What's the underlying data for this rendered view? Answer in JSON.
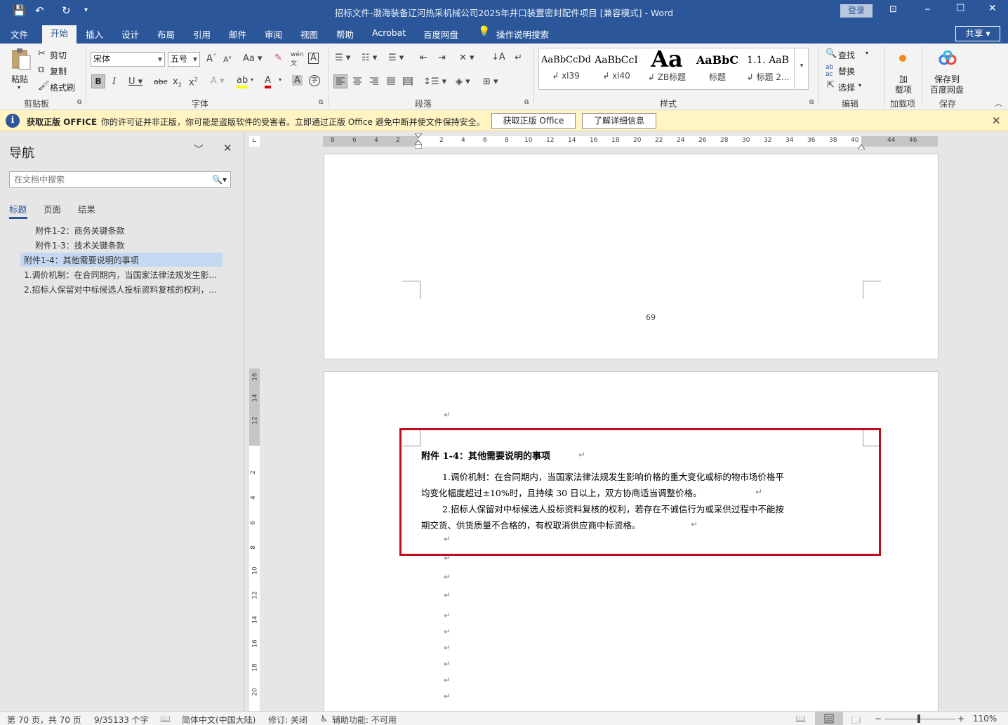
{
  "window": {
    "title": "招标文件-渤海装备辽河热采机械公司2025年井口装置密封配件项目 [兼容模式]  -  Word",
    "login": "登录",
    "controls": {
      "ribbon_display": "⊡",
      "minimize": "─",
      "maximize": "☐",
      "close": "✕"
    },
    "quick_access": {
      "save": "💾",
      "undo": "↶",
      "redo": "↻",
      "customize": "▾"
    }
  },
  "tabs": [
    "文件",
    "开始",
    "插入",
    "设计",
    "布局",
    "引用",
    "邮件",
    "审阅",
    "视图",
    "帮助",
    "Acrobat",
    "百度网盘"
  ],
  "tell_me": "操作说明搜索",
  "share": "共享",
  "ribbon": {
    "clipboard": {
      "paste": "粘贴",
      "cut": "剪切",
      "copy": "复制",
      "format_painter": "格式刷",
      "label": "剪贴板"
    },
    "font": {
      "font_name": "宋体",
      "font_size": "五号",
      "label": "字体",
      "bold": "B",
      "italic": "I",
      "underline": "U",
      "strike": "abc",
      "sub": "x₂",
      "sup": "x²",
      "grow": "A",
      "shrink": "A",
      "case": "Aa",
      "clear": "✎",
      "phonetic": "wén",
      "border_char": "A",
      "text_effects": "A",
      "highlight": "ab",
      "font_color": "A",
      "shade": "A",
      "enclose": "字"
    },
    "paragraph": {
      "label": "段落"
    },
    "styles": {
      "label": "样式",
      "items": [
        {
          "preview": "AaBbCcDd",
          "name": "↲ xl39"
        },
        {
          "preview": "AaBbCcI",
          "name": "↲ xl40"
        },
        {
          "preview": "Aa",
          "name": "↲ ZB标题"
        },
        {
          "preview": "AaBbC",
          "name": "标题"
        },
        {
          "preview": "1.1.  AaB",
          "name": "↲ 标题 2..."
        }
      ]
    },
    "editing": {
      "find": "查找",
      "replace": "替换",
      "select": "选择",
      "label": "编辑"
    },
    "addins": {
      "line1": "加",
      "line2": "载项",
      "label": "加载项"
    },
    "save_cloud": {
      "line1": "保存到",
      "line2": "百度网盘",
      "label": "保存"
    }
  },
  "warning": {
    "icon": "i",
    "title": "获取正版 OFFICE",
    "message": "你的许可证并非正版，你可能是盗版软件的受害者。立即通过正版 Office 避免中断并使文件保持安全。",
    "button_primary": "获取正版 Office",
    "button_secondary": "了解详细信息"
  },
  "nav": {
    "title": "导航",
    "search_placeholder": "在文档中搜索",
    "tabs": [
      "标题",
      "页面",
      "结果"
    ],
    "items": [
      {
        "text": "附件1-2：商务关键条款",
        "level": 2
      },
      {
        "text": "附件1-3：技术关键条款",
        "level": 2
      },
      {
        "text": "附件1-4：其他需要说明的事项",
        "level": 1,
        "selected": true
      },
      {
        "text": "1.调价机制：在合同期内，当国家法律法规发生影...",
        "level": 1
      },
      {
        "text": "2.招标人保留对中标候选人投标资料复核的权利，...",
        "level": 1
      }
    ]
  },
  "ruler": {
    "h_numbers": [
      "8",
      "6",
      "4",
      "2",
      "2",
      "4",
      "6",
      "8",
      "10",
      "12",
      "14",
      "16",
      "18",
      "20",
      "22",
      "24",
      "26",
      "28",
      "30",
      "32",
      "34",
      "36",
      "38",
      "40",
      "44",
      "46"
    ],
    "v_numbers": [
      "16",
      "14",
      "12",
      "2",
      "4",
      "6",
      "8",
      "10",
      "12",
      "14",
      "16",
      "18",
      "20"
    ]
  },
  "document": {
    "page_number": "69",
    "heading": "附件 1-4：其他需要说明的事项",
    "para1_line1": "1.调价机制：在合同期内，当国家法律法规发生影响价格的重大变化或标的物市场价格平",
    "para1_line2": "均变化幅度超过±10%时，且持续 30 日以上，双方协商适当调整价格。",
    "para2_line1": "2.招标人保留对中标候选人投标资料复核的权利，若存在不诚信行为或采供过程中不能按",
    "para2_line2": "期交货、供货质量不合格的，有权取消供应商中标资格。",
    "para_mark": "↵"
  },
  "status": {
    "page": "第 70 页，共 70 页",
    "words": "9/35133 个字",
    "language": "简体中文(中国大陆)",
    "track": "修订: 关闭",
    "accessibility": "辅助功能: 不可用",
    "zoom": "110%",
    "zoom_minus": "−",
    "zoom_plus": "+"
  }
}
